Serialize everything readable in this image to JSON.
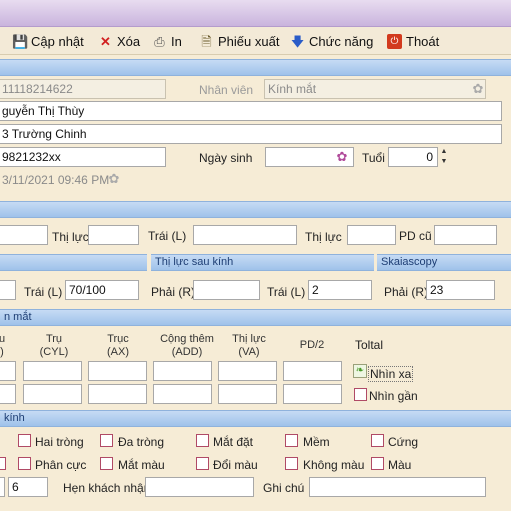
{
  "colors": {
    "accent": "#9fc2ea",
    "background": "#f6ecd6",
    "titlebar": "#c9b4dd"
  },
  "toolbar": {
    "update": {
      "label": "Cập nhật",
      "icon": "save-icon"
    },
    "delete": {
      "label": "Xóa",
      "icon": "delete-icon"
    },
    "print": {
      "label": "In",
      "icon": "printer-icon"
    },
    "export": {
      "label": "Phiếu xuất",
      "icon": "document-export-icon"
    },
    "functions": {
      "label": "Chức năng",
      "icon": "arrow-down-icon"
    },
    "exit": {
      "label": "Thoát",
      "icon": "exit-icon"
    }
  },
  "customer": {
    "code": "11118214622",
    "staff_label": "Nhân viên",
    "staff_value": "Kính mắt",
    "name": "guyễn Thị Thùy",
    "address": "3 Trường Chinh",
    "phone": "9821232xx",
    "dob_label": "Ngày sinh",
    "dob_value": "",
    "age_label": "Tuổi",
    "age_value": "0",
    "created": "3/11/2021 09:46 PM"
  },
  "vision_old": {
    "thi_luc_1": "Thị lực",
    "left_label": "Trái (L)",
    "thi_luc_2": "Thị lực",
    "pd_old_label": "PD cũ"
  },
  "sections": {
    "after_glasses": "Thị lực sau kính",
    "skiascopy": "Skaiascopy",
    "eye": "n mắt",
    "glasses": "kính"
  },
  "before": {
    "left_label": "Trái (L)",
    "left_value": "70/100"
  },
  "after": {
    "right_label": "Phải (R)",
    "right_value": "",
    "left_label": "Trái (L)",
    "left_value": "2"
  },
  "skia": {
    "right_label": "Phải (R)",
    "right_value": "23"
  },
  "prescription": {
    "headers": [
      {
        "top": "u",
        "bottom": ")"
      },
      {
        "top": "Trụ",
        "bottom": "(CYL)"
      },
      {
        "top": "Trục",
        "bottom": "(AX)"
      },
      {
        "top": "Cộng thêm",
        "bottom": "(ADD)"
      },
      {
        "top": "Thị lực",
        "bottom": "(VA)"
      },
      {
        "top": "PD/2",
        "bottom": ""
      }
    ],
    "total_label": "Toltal",
    "far_label": "Nhìn xa",
    "near_label": "Nhìn gần"
  },
  "lens_types": [
    {
      "label": "Hai tròng"
    },
    {
      "label": "Đa tròng"
    },
    {
      "label": "Mắt đặt"
    },
    {
      "label": "Mềm"
    },
    {
      "label": "Cứng"
    },
    {
      "label": "Phân cực"
    },
    {
      "label": "Mắt màu"
    },
    {
      "label": "Đổi màu"
    },
    {
      "label": "Không màu"
    },
    {
      "label": "Màu"
    }
  ],
  "footer": {
    "value_left": "6",
    "appointment_label": "Hẹn khách nhận",
    "appointment_value": "",
    "note_label": "Ghi chú",
    "note_value": ""
  }
}
